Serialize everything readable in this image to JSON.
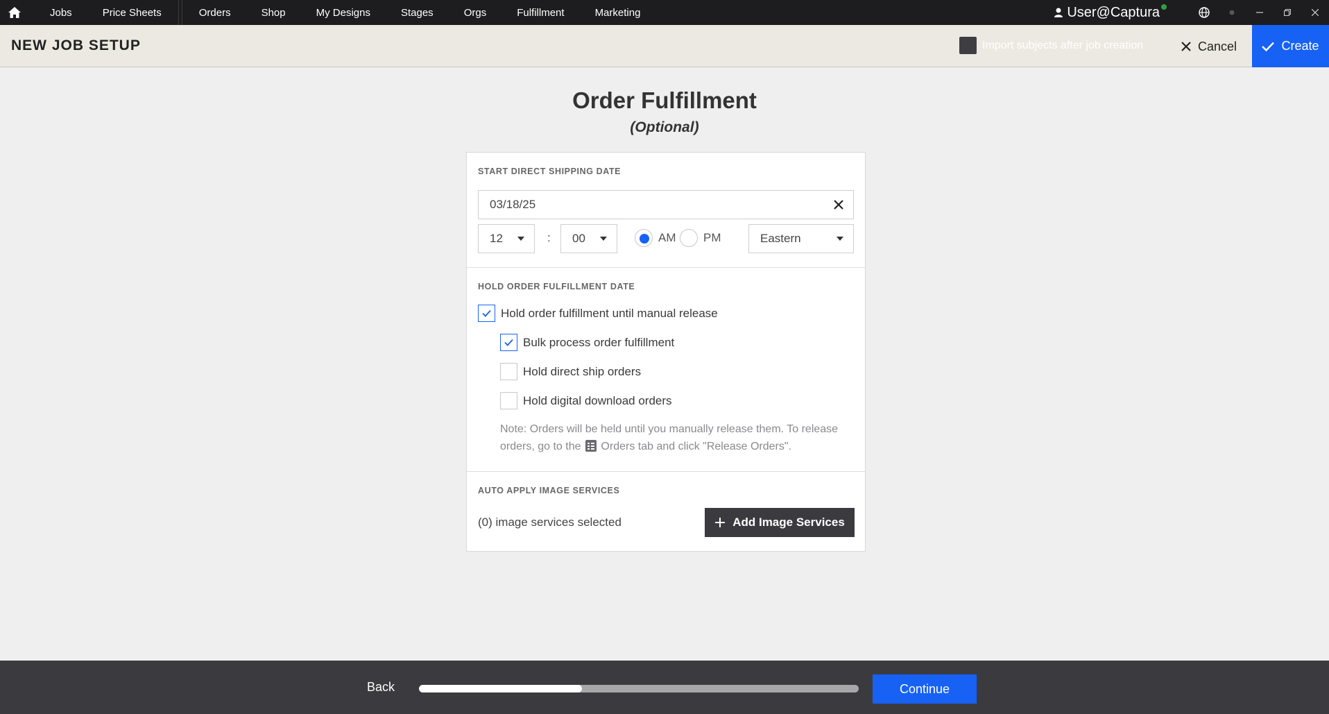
{
  "nav": {
    "home_icon": "home-icon",
    "items": [
      "Jobs",
      "Price Sheets",
      "Orders",
      "Shop",
      "My Designs",
      "Stages",
      "Orgs",
      "Fulfillment",
      "Marketing"
    ],
    "user": "User@Captura",
    "icons": [
      "user-icon",
      "globe-icon",
      "status-dot-icon",
      "minimize-icon",
      "restore-icon",
      "close-icon"
    ]
  },
  "header": {
    "title": "NEW JOB SETUP",
    "import_label": "Import subjects after job creation",
    "import_checked": false,
    "cancel_label": "Cancel",
    "create_label": "Create"
  },
  "page": {
    "title": "Order Fulfillment",
    "subtitle": "(Optional)"
  },
  "shipping": {
    "label": "START DIRECT SHIPPING DATE",
    "date": "03/18/25",
    "hour": "12",
    "separator": ":",
    "minute": "00",
    "am_label": "AM",
    "pm_label": "PM",
    "selected_period": "AM",
    "timezone": "Eastern"
  },
  "hold": {
    "label": "HOLD ORDER FULFILLMENT DATE",
    "options": [
      {
        "label": "Hold order fulfillment until manual release",
        "checked": true
      },
      {
        "label": "Bulk process order fulfillment",
        "checked": true
      },
      {
        "label": "Hold direct ship orders",
        "checked": false
      },
      {
        "label": "Hold digital download orders",
        "checked": false
      }
    ],
    "note_prefix": "Note: Orders will be held until you manually release them. To release orders, go to the",
    "note_suffix": "Orders tab and click \"Release Orders\"."
  },
  "services": {
    "label": "AUTO APPLY IMAGE SERVICES",
    "count_text": "(0) image services selected",
    "add_label": "Add Image Services"
  },
  "footer": {
    "back_label": "Back",
    "continue_label": "Continue",
    "progress_percent": 37
  },
  "colors": {
    "accent": "#1761f5",
    "nav_bg": "#1d1d1f",
    "header_bg": "#ebe9e1",
    "footer_bg": "#3b3b3f"
  }
}
